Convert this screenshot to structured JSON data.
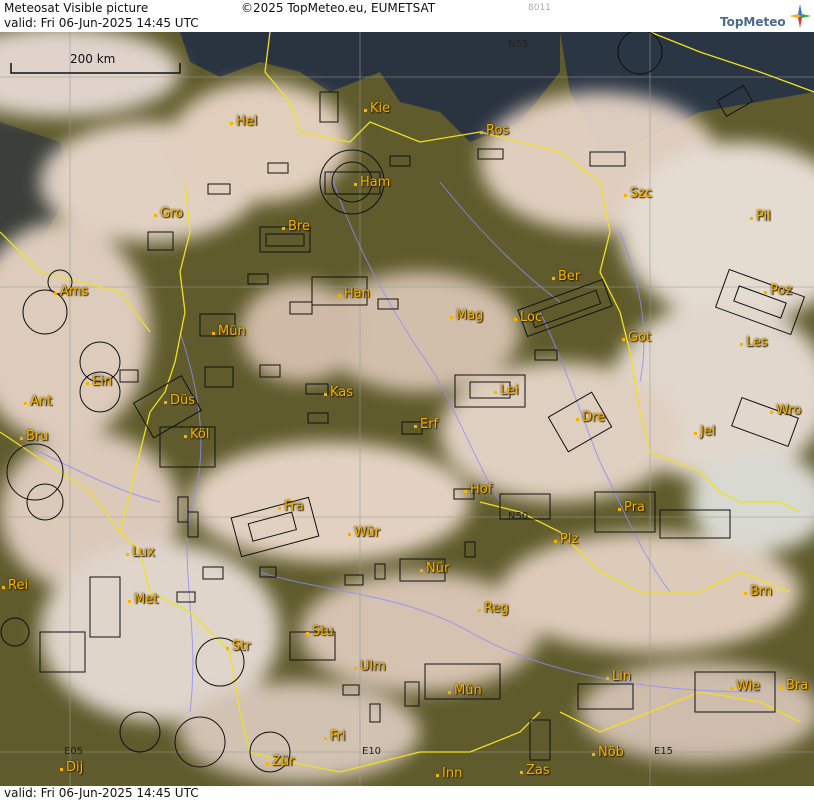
{
  "header": {
    "title": "Meteosat Visible picture",
    "valid_line": "valid:  Fri  06-Jun-2025  14:45 UTC",
    "copyright": "©2025 TopMeteo.eu, EUMETSAT",
    "image_code": "8011",
    "brand": "TopMeteo"
  },
  "footer": {
    "valid_line": "valid:  Fri  06-Jun-2025  14:45 UTC"
  },
  "scale_bar": {
    "label": "200 km"
  },
  "grid_labels": [
    "N55",
    "N50",
    "E05",
    "E10",
    "E15"
  ],
  "cities": [
    "Hel",
    "Kie",
    "Ros",
    "Ham",
    "Szc",
    "Gro",
    "Bre",
    "Pil",
    "Ams",
    "Ber",
    "Han",
    "Poz",
    "Mün",
    "Mag",
    "Loc",
    "Got",
    "Les",
    "Ein",
    "Lei",
    "Ant",
    "Düs",
    "Kas",
    "Wro",
    "Bru",
    "Köl",
    "Erf",
    "Dre",
    "Jel",
    "Hof",
    "Fra",
    "Pra",
    "Lux",
    "Wür",
    "Plz",
    "Rei",
    "Nür",
    "Met",
    "Brn",
    "Reg",
    "Stu",
    "Str",
    "Ulm",
    "Lin",
    "Mün",
    "Wie",
    "Bra",
    "Fri",
    "Zür",
    "Dij",
    "Inn",
    "Zas",
    "Nöb"
  ],
  "colors": {
    "border_line": "#f0e020",
    "river_line": "#8c8cff",
    "grid_line": "#9a9a9a",
    "label_color": "#f2b400",
    "airspace_line": "#111111",
    "land": "#5d5a2a",
    "cloud": "#e8d6c8",
    "sea": "#2a3340"
  }
}
